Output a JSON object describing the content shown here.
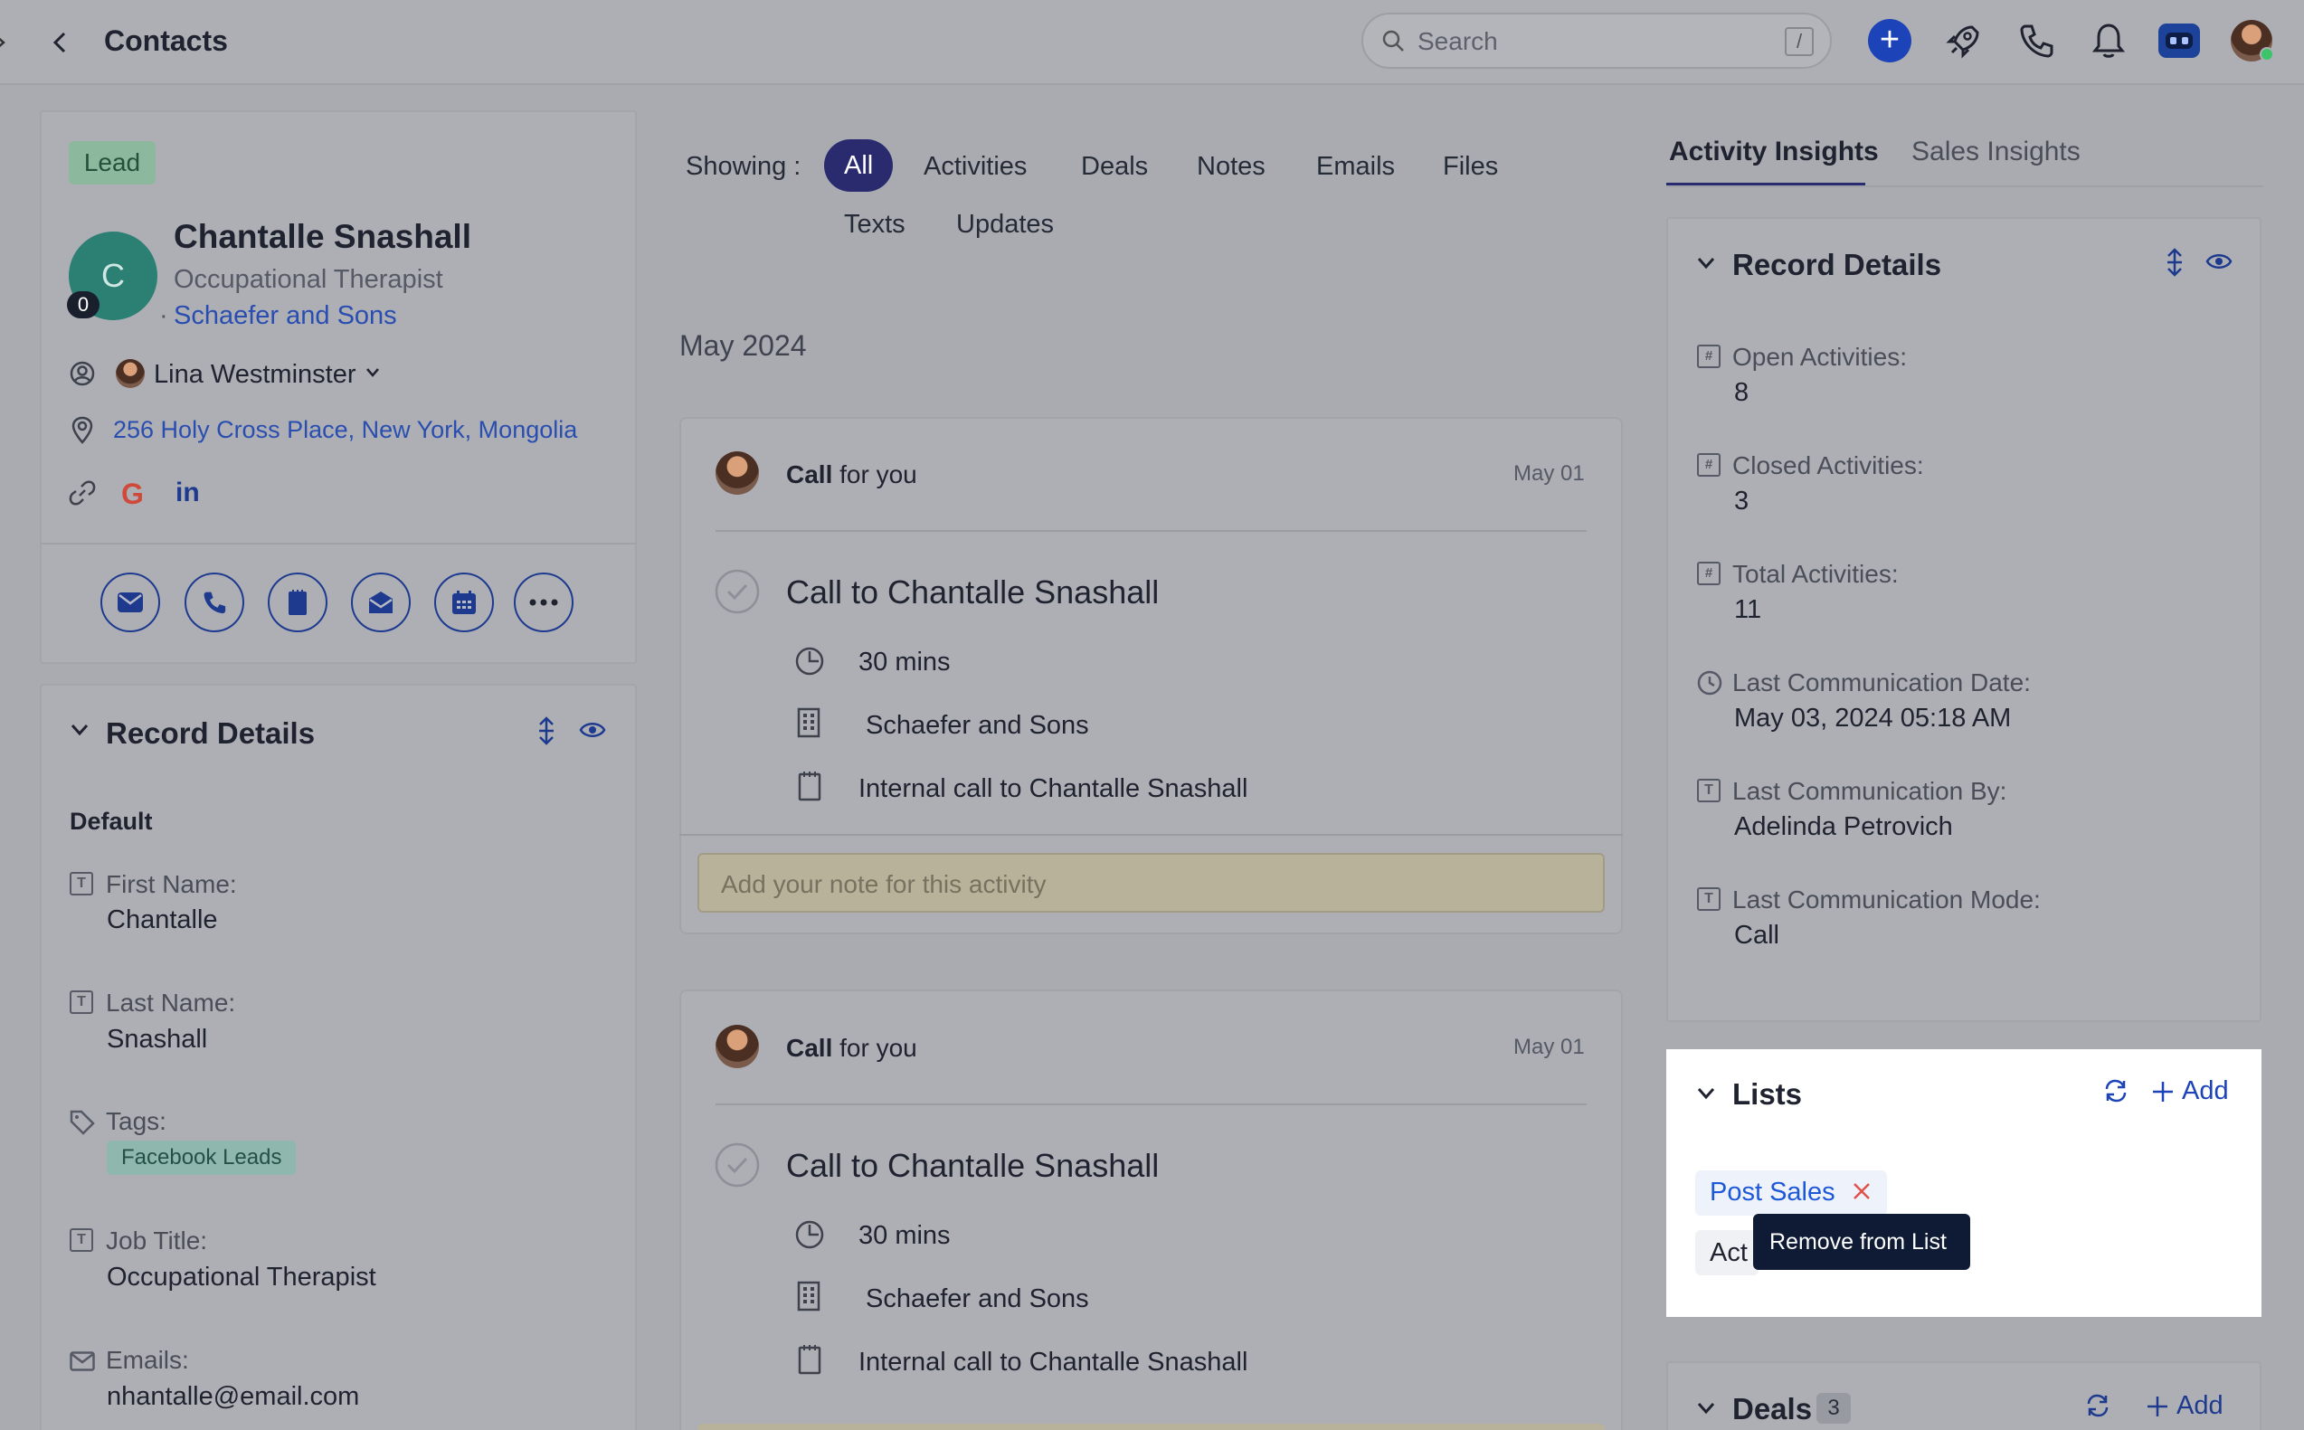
{
  "header": {
    "title": "Contacts",
    "search_placeholder": "Search",
    "search_shortcut": "/"
  },
  "contact": {
    "badge": "Lead",
    "avatar_initial": "C",
    "avatar_count": "0",
    "name": "Chantalle Snashall",
    "job_title": "Occupational Therapist",
    "company_prefix": "·",
    "company": "Schaefer and Sons",
    "owner": "Lina Westminster",
    "address": "256 Holy Cross Place, New York, Mongolia"
  },
  "left_details": {
    "title": "Record Details",
    "group": "Default",
    "fields": [
      {
        "label": "First Name:",
        "value": "Chantalle"
      },
      {
        "label": "Last Name:",
        "value": "Snashall"
      },
      {
        "label": "Tags:",
        "value": "Facebook Leads"
      },
      {
        "label": "Job Title:",
        "value": "Occupational Therapist"
      },
      {
        "label": "Emails:",
        "value": "nhantalle@email.com"
      }
    ]
  },
  "filters": {
    "label": "Showing :",
    "items": [
      "All",
      "Activities",
      "Deals",
      "Notes",
      "Emails",
      "Files",
      "Texts",
      "Updates"
    ]
  },
  "timeline": {
    "month": "May 2024",
    "activities": [
      {
        "header_bold": "Call",
        "header_rest": "for you",
        "date": "May 01",
        "title": "Call to Chantalle Snashall",
        "duration": "30 mins",
        "company": "Schaefer and Sons",
        "description": "Internal call to Chantalle Snashall",
        "note_placeholder": "Add your note for this activity"
      },
      {
        "header_bold": "Call",
        "header_rest": "for you",
        "date": "May 01",
        "title": "Call to Chantalle Snashall",
        "duration": "30 mins",
        "company": "Schaefer and Sons",
        "description": "Internal call to Chantalle Snashall"
      }
    ]
  },
  "right": {
    "tabs": [
      "Activity Insights",
      "Sales Insights"
    ],
    "details_title": "Record Details",
    "fields": [
      {
        "label": "Open Activities:",
        "value": "8"
      },
      {
        "label": "Closed Activities:",
        "value": "3"
      },
      {
        "label": "Total Activities:",
        "value": "11"
      },
      {
        "label": "Last Communication Date:",
        "value": "May 03, 2024 05:18 AM"
      },
      {
        "label": "Last Communication By:",
        "value": "Adelinda Petrovich"
      },
      {
        "label": "Last Communication Mode:",
        "value": "Call"
      }
    ],
    "lists": {
      "title": "Lists",
      "add_label": "Add",
      "chips": [
        "Post Sales",
        "Act"
      ],
      "tooltip": "Remove from List"
    },
    "deals": {
      "title": "Deals",
      "count": "3",
      "add_label": "Add"
    }
  },
  "colors": {
    "accent": "#1d43b8",
    "filter_active": "#2a2b6e",
    "remove_red": "#e0524a",
    "tooltip_bg": "#0f1a35"
  }
}
